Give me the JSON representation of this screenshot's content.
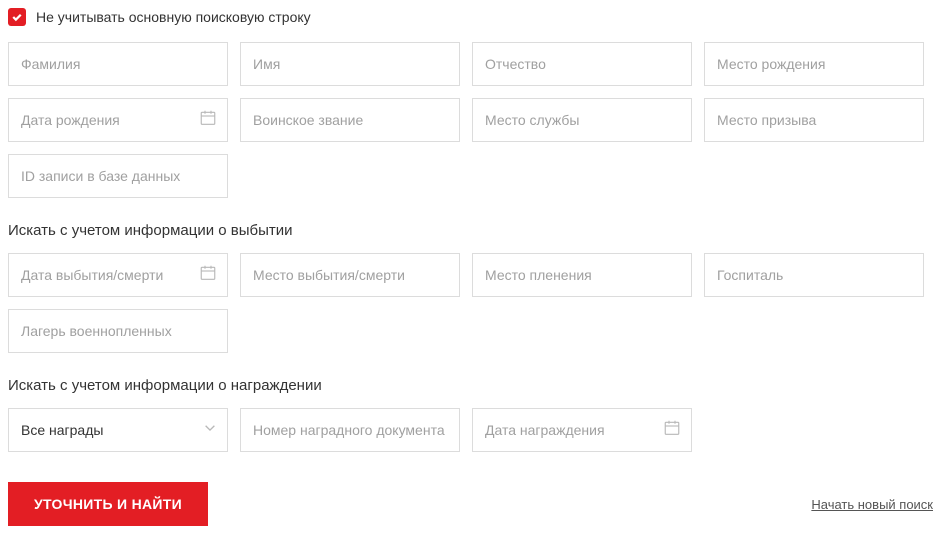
{
  "checkbox": {
    "label": "Не учитывать основную поисковую строку",
    "checked": true
  },
  "fields": {
    "lastname": {
      "placeholder": "Фамилия"
    },
    "firstname": {
      "placeholder": "Имя"
    },
    "patronymic": {
      "placeholder": "Отчество"
    },
    "birthplace": {
      "placeholder": "Место рождения"
    },
    "birthdate": {
      "placeholder": "Дата рождения"
    },
    "rank": {
      "placeholder": "Воинское звание"
    },
    "service_place": {
      "placeholder": "Место службы"
    },
    "draft_place": {
      "placeholder": "Место призыва"
    },
    "record_id": {
      "placeholder": "ID записи в базе данных"
    }
  },
  "departure": {
    "title": "Искать с учетом информации о выбытии",
    "fields": {
      "departure_date": {
        "placeholder": "Дата выбытия/смерти"
      },
      "departure_place": {
        "placeholder": "Место выбытия/смерти"
      },
      "capture_place": {
        "placeholder": "Место пленения"
      },
      "hospital": {
        "placeholder": "Госпиталь"
      },
      "pow_camp": {
        "placeholder": "Лагерь военнопленных"
      }
    }
  },
  "awards": {
    "title": "Искать с учетом информации о награждении",
    "fields": {
      "award_select": {
        "label": "Все награды"
      },
      "award_doc_number": {
        "placeholder": "Номер наградного документа"
      },
      "award_date": {
        "placeholder": "Дата награждения"
      }
    }
  },
  "actions": {
    "submit": "УТОЧНИТЬ И НАЙТИ",
    "new_search": "Начать новый поиск"
  }
}
